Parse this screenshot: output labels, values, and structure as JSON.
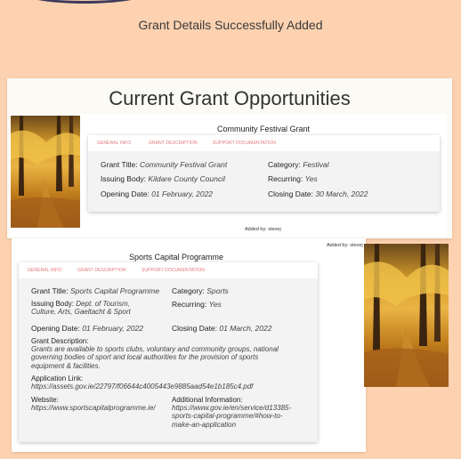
{
  "flash": {
    "message": "Grant Details Successfully Added"
  },
  "section": {
    "title": "Current Grant Opportunities"
  },
  "tabs": {
    "general": "GENERAL INFO",
    "description": "GRANT DESCRIPTION",
    "support": "SUPPORT DOCUMENTATION"
  },
  "grants": [
    {
      "title": "Community Festival Grant",
      "fields": {
        "grant_title_label": "Grant Title:",
        "grant_title": "Community Festival Grant",
        "issuing_body_label": "Issuing Body:",
        "issuing_body": "Kildare County Council",
        "opening_date_label": "Opening Date:",
        "opening_date": "01 February, 2022",
        "category_label": "Category:",
        "category": "Festival",
        "recurring_label": "Recurring:",
        "recurring": "Yes",
        "closing_date_label": "Closing Date:",
        "closing_date": "30 March, 2022"
      },
      "added_by": "Added by: stevej"
    },
    {
      "title": "Sports Capital Programme",
      "fields": {
        "grant_title_label": "Grant Title:",
        "grant_title": "Sports Capital Programme",
        "issuing_body_label": "Issuing Body:",
        "issuing_body_line1": "Dept. of Tourism,",
        "issuing_body_line2": "Culture, Arts, Gaeltacht & Sport",
        "opening_date_label": "Opening Date:",
        "opening_date": "01 February, 2022",
        "category_label": "Category:",
        "category": "Sports",
        "recurring_label": "Recurring:",
        "recurring": "Yes",
        "closing_date_label": "Closing Date:",
        "closing_date": "01 March, 2022",
        "description_label": "Grant Description:",
        "description_1": "Grants are available to sports clubs, voluntary and community groups, national",
        "description_2": "governing bodies of sport and local authorities for the provision of sports",
        "description_3": "equipment & facilities.",
        "application_label": "Application Link:",
        "application_link": "https://assets.gov.ie/22797/f06644c4005443e9885aad54e1b185c4.pdf",
        "website_label": "Website:",
        "website": "https://www.sportscapitalprogramme.ie/",
        "additional_label": "Additional Information:",
        "additional_1": "https://www.gov.ie/en/service/d13385-",
        "additional_2": "sports-capital-programme/#how-to-",
        "additional_3": "make-an-application"
      },
      "added_by": "Added by: stevej"
    }
  ]
}
